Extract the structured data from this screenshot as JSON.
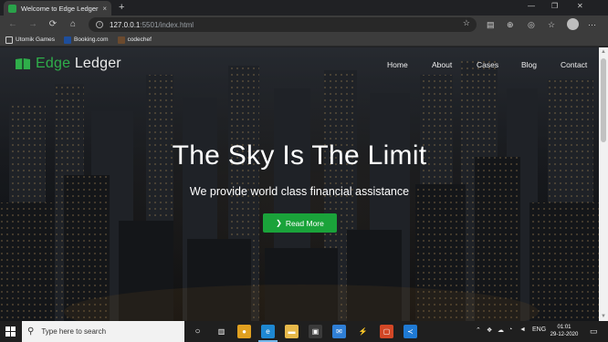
{
  "browser": {
    "tab": {
      "title": "Welcome to Edge Ledger",
      "close": "×"
    },
    "new_tab": "+",
    "window": {
      "minimize": "—",
      "restore": "❐",
      "close": "✕"
    },
    "nav": {
      "back": "←",
      "forward": "→",
      "refresh": "⟳",
      "home": "⌂"
    },
    "address": {
      "host": "127.0.0.1",
      "path": ":5501/index.html",
      "favorite": "☆"
    },
    "bookmarks": [
      {
        "label": "Utomik Games",
        "icon": "bookmark-icon",
        "color": "#e0e0e0"
      },
      {
        "label": "Booking.com",
        "icon": "booking-icon",
        "color": "#1e4e9c"
      },
      {
        "label": "codechef",
        "icon": "codechef-icon",
        "color": "#6b4a2e"
      }
    ]
  },
  "site": {
    "brand": {
      "word1": "Edge",
      "word2": " Ledger",
      "accent_color": "#2fae4a"
    },
    "nav": [
      "Home",
      "About",
      "Cases",
      "Blog",
      "Contact"
    ],
    "hero": {
      "title": "The Sky Is The Limit",
      "subtitle": "We provide world class financial assistance",
      "cta": "Read More",
      "cta_color": "#1aa33a"
    }
  },
  "taskbar": {
    "search_placeholder": "Type here to search",
    "language": "ENG",
    "time": "01:01",
    "date": "29-12-2020"
  }
}
